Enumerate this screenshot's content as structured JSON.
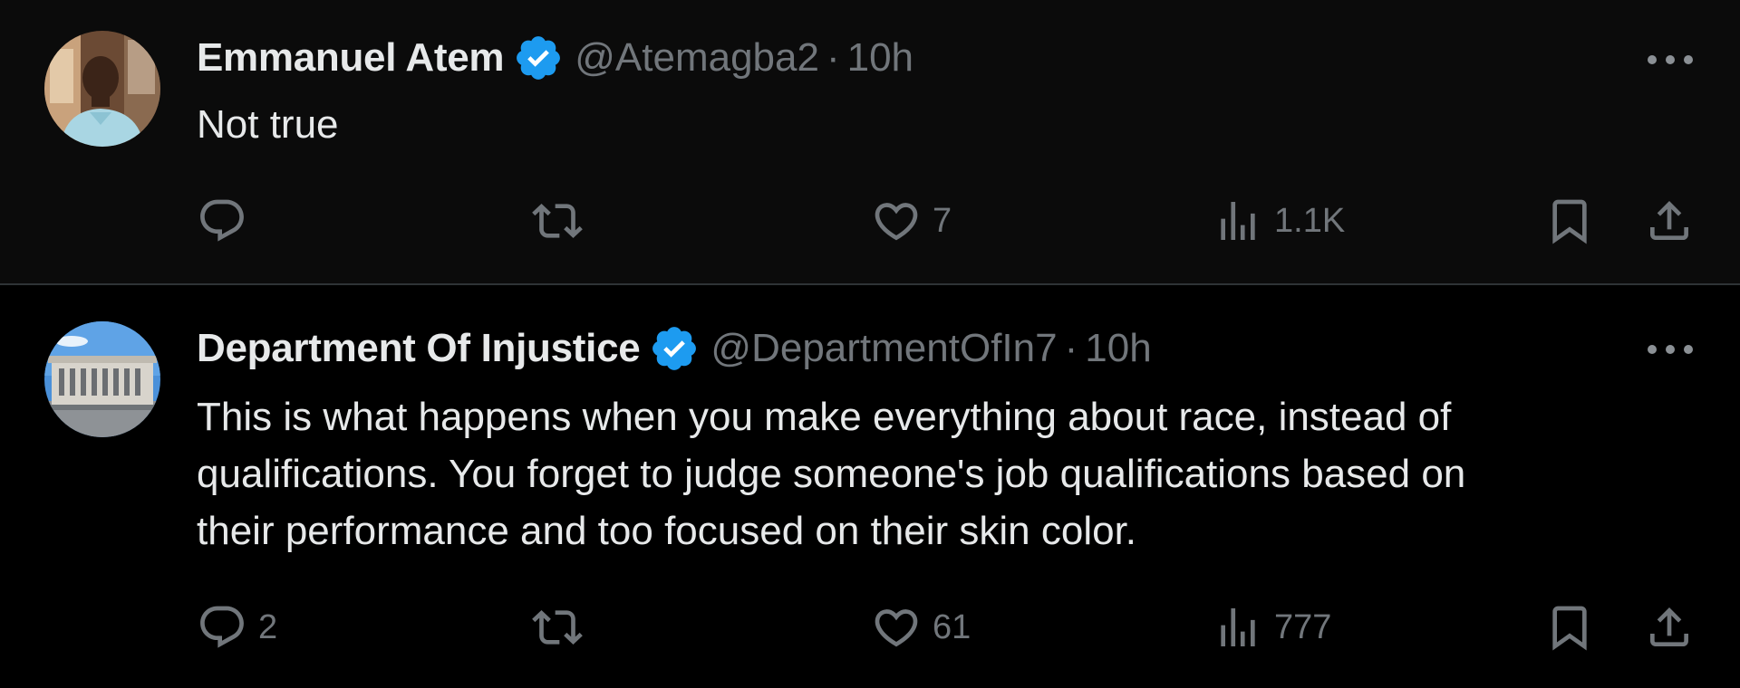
{
  "tweets": [
    {
      "author_name": "Emmanuel Atem",
      "handle": "@Atemagba2",
      "separator": "·",
      "time": "10h",
      "text": "Not true",
      "stats": {
        "replies": "",
        "retweets": "",
        "likes": "7",
        "views": "1.1K"
      }
    },
    {
      "author_name": "Department Of Injustice",
      "handle": "@DepartmentOfIn7",
      "separator": "·",
      "time": "10h",
      "text": "This is what happens when you make everything about race, instead of\nqualifications.   You forget to judge someone's job qualifications based on\ntheir performance and too focused on their skin color.",
      "stats": {
        "replies": "2",
        "retweets": "",
        "likes": "61",
        "views": "777"
      }
    }
  ],
  "icons": {
    "verified": "verified-badge-icon",
    "reply": "reply-icon",
    "retweet": "retweet-icon",
    "like": "heart-icon",
    "views": "views-icon",
    "bookmark": "bookmark-icon",
    "share": "share-icon",
    "more": "more-icon"
  },
  "colors": {
    "background": "#000000",
    "text_primary": "#e7e9ea",
    "text_secondary": "#71767b",
    "verified_blue": "#1d9bf0",
    "divider": "#2f3336"
  }
}
